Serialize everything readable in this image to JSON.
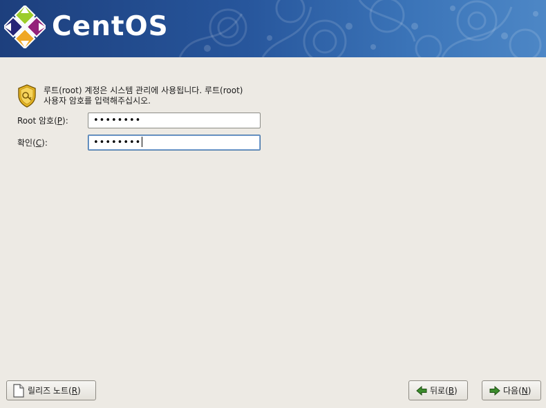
{
  "banner": {
    "brand": "CentOS",
    "logo_icon": "centos-logo-icon"
  },
  "root_password": {
    "icon": "shield-key-icon",
    "description_line1": "루트(root) 계정은 시스템 관리에 사용됩니다. 루트(root)",
    "description_line2": "사용자 암호를 입력해주십시오.",
    "password_label_prefix": "Root 암호(",
    "password_label_mnemonic": "P",
    "password_label_suffix": "):",
    "password_value": "••••••••",
    "confirm_label_prefix": "확인(",
    "confirm_label_mnemonic": "C",
    "confirm_label_suffix": "):",
    "confirm_value": "••••••••"
  },
  "footer": {
    "release_notes_prefix": "릴리즈 노트(",
    "release_notes_mnemonic": "R",
    "release_notes_suffix": ")",
    "release_notes_icon": "document-icon",
    "back_prefix": "뒤로(",
    "back_mnemonic": "B",
    "back_suffix": ")",
    "back_icon": "arrow-left-icon",
    "next_prefix": "다음(",
    "next_mnemonic": "N",
    "next_suffix": ")",
    "next_icon": "arrow-right-icon"
  },
  "colors": {
    "banner_dark": "#1d3f7d",
    "banner_light": "#4d87c6",
    "window_bg": "#edeae4",
    "focus_border": "#3a6ea5"
  }
}
